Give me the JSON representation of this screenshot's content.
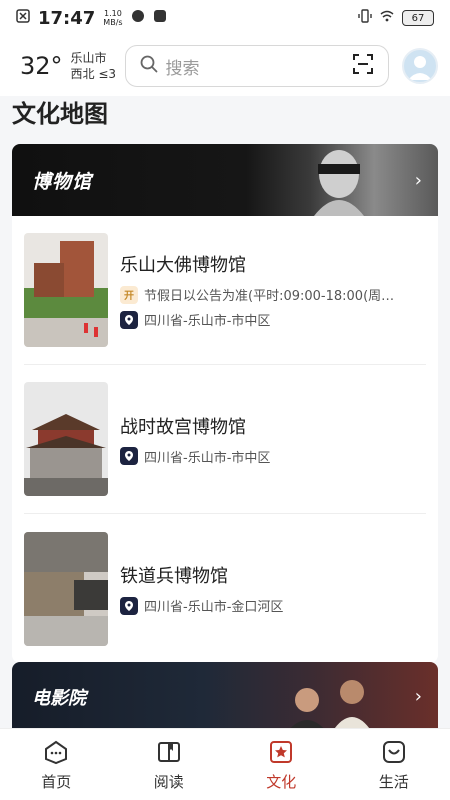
{
  "status_bar": {
    "time": "17:47",
    "net_speed_value": "1.10",
    "net_speed_unit": "MB/s",
    "battery": "67"
  },
  "header": {
    "temperature": "32°",
    "city": "乐山市",
    "wind": "西北 ≤3",
    "search_placeholder": "搜索"
  },
  "page_title": "文化地图",
  "museums_section": {
    "title": "博物馆",
    "items": [
      {
        "name": "乐山大佛博物馆",
        "hours_tag": "开",
        "hours": "节假日以公告为准(平时:09:00-18:00(周…",
        "location": "四川省-乐山市-市中区"
      },
      {
        "name": "战时故宫博物馆",
        "location": "四川省-乐山市-市中区"
      },
      {
        "name": "铁道兵博物馆",
        "location": "四川省-乐山市-金口河区"
      }
    ]
  },
  "cinema_section": {
    "title": "电影院"
  },
  "tab_bar": {
    "tabs": [
      {
        "label": "首页",
        "icon": "home-icon"
      },
      {
        "label": "阅读",
        "icon": "book-icon"
      },
      {
        "label": "文化",
        "icon": "culture-icon"
      },
      {
        "label": "生活",
        "icon": "life-icon"
      }
    ],
    "active_index": 2
  },
  "colors": {
    "accent": "#c0392b",
    "location_tag": "#1c2340",
    "open_tag_bg": "#fbead2"
  }
}
